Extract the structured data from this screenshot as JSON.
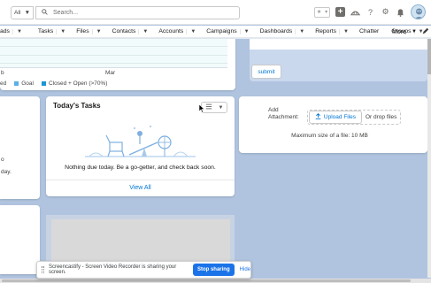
{
  "header": {
    "scope_label": "All",
    "search_placeholder": "Search..."
  },
  "nav": {
    "items": [
      {
        "label": "ads"
      },
      {
        "label": "Tasks"
      },
      {
        "label": "Files"
      },
      {
        "label": "Contacts"
      },
      {
        "label": "Accounts"
      },
      {
        "label": "Campaigns"
      },
      {
        "label": "Dashboards"
      },
      {
        "label": "Reports"
      },
      {
        "label": "Chatter"
      },
      {
        "label": "Groups"
      }
    ],
    "more_label": "More"
  },
  "chart_fragment": {
    "x_label_left": "b",
    "x_label_mar": "Mar",
    "legend": [
      {
        "label": "ed",
        "color": "#5ab0e8"
      },
      {
        "label": "Goal",
        "color": "#5ab0e8"
      },
      {
        "label": "Closed + Open (>70%)",
        "color": "#1b96d4"
      }
    ]
  },
  "left_fragment": {
    "line1": "o",
    "line2": "day."
  },
  "tasks_card": {
    "title": "Today's Tasks",
    "empty_message": "Nothing due today. Be a go-getter, and check back soon.",
    "view_all": "View All"
  },
  "submit_card": {
    "submit_label": "submit"
  },
  "attachment_card": {
    "add_label": "Add",
    "attachment_label": "Attachment:",
    "upload_label": "Upload Files",
    "drop_label": "Or drop files",
    "max_size": "Maximum size of a file: 10 MB"
  },
  "screen_share": {
    "message": "Screencastify - Screen Video Recorder is sharing your screen.",
    "stop_label": "Stop sharing",
    "hide_label": "Hide"
  }
}
